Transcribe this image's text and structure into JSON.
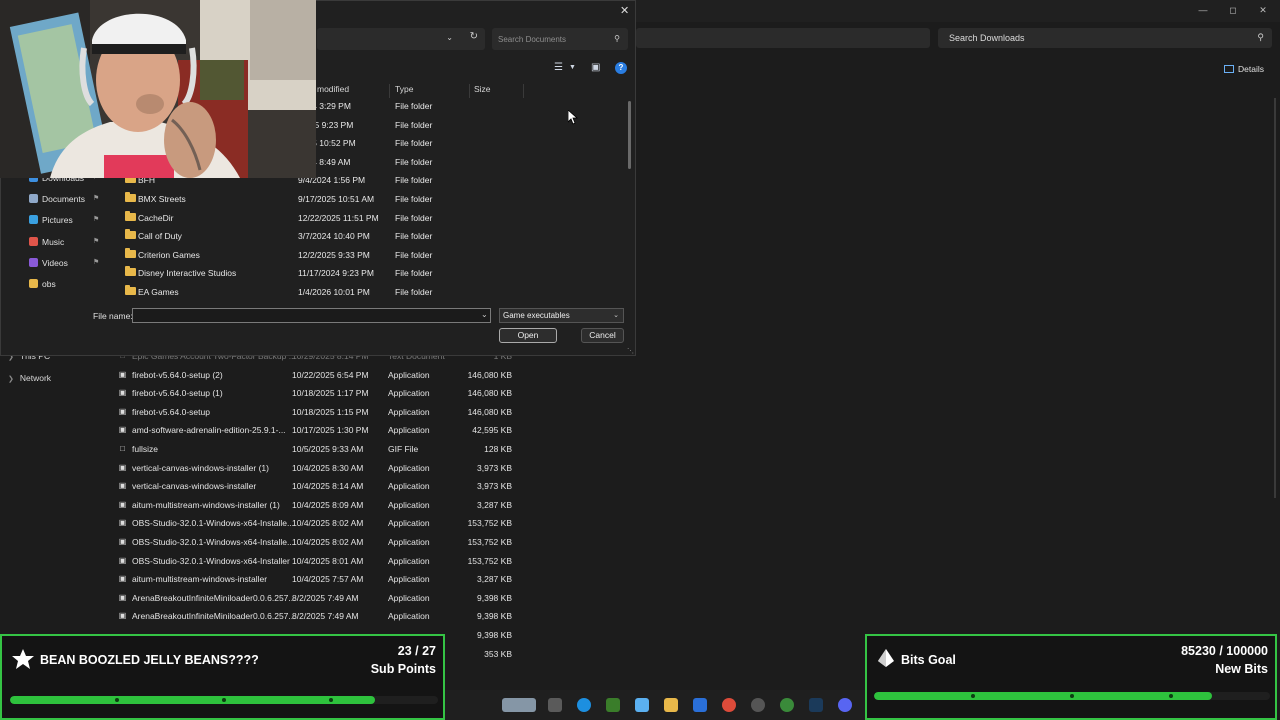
{
  "background_explorer": {
    "search_placeholder": "Search Downloads",
    "details_label": "Details",
    "nav": [
      {
        "label": "This PC"
      },
      {
        "label": "Network"
      }
    ],
    "files": [
      {
        "name": "Epic Games Account Two-Factor Backup ...",
        "date": "10/29/2025 8:14 PM",
        "type": "Text Document",
        "size": "1 KB"
      },
      {
        "name": "firebot-v5.64.0-setup (2)",
        "date": "10/22/2025 6:54 PM",
        "type": "Application",
        "size": "146,080 KB"
      },
      {
        "name": "firebot-v5.64.0-setup (1)",
        "date": "10/18/2025 1:17 PM",
        "type": "Application",
        "size": "146,080 KB"
      },
      {
        "name": "firebot-v5.64.0-setup",
        "date": "10/18/2025 1:15 PM",
        "type": "Application",
        "size": "146,080 KB"
      },
      {
        "name": "amd-software-adrenalin-edition-25.9.1-...",
        "date": "10/17/2025 1:30 PM",
        "type": "Application",
        "size": "42,595 KB"
      },
      {
        "name": "fullsize",
        "date": "10/5/2025 9:33 AM",
        "type": "GIF File",
        "size": "128 KB"
      },
      {
        "name": "vertical-canvas-windows-installer (1)",
        "date": "10/4/2025 8:30 AM",
        "type": "Application",
        "size": "3,973 KB"
      },
      {
        "name": "vertical-canvas-windows-installer",
        "date": "10/4/2025 8:14 AM",
        "type": "Application",
        "size": "3,973 KB"
      },
      {
        "name": "aitum-multistream-windows-installer (1)",
        "date": "10/4/2025 8:09 AM",
        "type": "Application",
        "size": "3,287 KB"
      },
      {
        "name": "OBS-Studio-32.0.1-Windows-x64-Installe...",
        "date": "10/4/2025 8:02 AM",
        "type": "Application",
        "size": "153,752 KB"
      },
      {
        "name": "OBS-Studio-32.0.1-Windows-x64-Installe...",
        "date": "10/4/2025 8:02 AM",
        "type": "Application",
        "size": "153,752 KB"
      },
      {
        "name": "OBS-Studio-32.0.1-Windows-x64-Installer",
        "date": "10/4/2025 8:01 AM",
        "type": "Application",
        "size": "153,752 KB"
      },
      {
        "name": "aitum-multistream-windows-installer",
        "date": "10/4/2025 7:57 AM",
        "type": "Application",
        "size": "3,287 KB"
      },
      {
        "name": "ArenaBreakoutInfiniteMiniloader0.0.6.257...",
        "date": "8/2/2025 7:49 AM",
        "type": "Application",
        "size": "9,398 KB"
      },
      {
        "name": "ArenaBreakoutInfiniteMiniloader0.0.6.257...",
        "date": "8/2/2025 7:49 AM",
        "type": "Application",
        "size": "9,398 KB"
      },
      {
        "name": "",
        "date": "",
        "type": "",
        "size": "9,398 KB"
      },
      {
        "name": "",
        "date": "",
        "type": "",
        "size": "353 KB"
      }
    ]
  },
  "dialog": {
    "search_placeholder": "Search Documents",
    "columns": {
      "modified": "modified",
      "type": "Type",
      "size": "Size"
    },
    "top_rows": [
      {
        "date": "2024 3:29 PM",
        "type": "File folder"
      },
      {
        "date": "/2025 9:23 PM",
        "type": "File folder"
      },
      {
        "date": "2025 10:52 PM",
        "type": "File folder"
      },
      {
        "date": "2024 8:49 AM",
        "type": "File folder"
      }
    ],
    "folders": [
      {
        "name": "BFH",
        "date": "9/4/2024 1:56 PM",
        "type": "File folder"
      },
      {
        "name": "BMX Streets",
        "date": "9/17/2025 10:51 AM",
        "type": "File folder"
      },
      {
        "name": "CacheDir",
        "date": "12/22/2025 11:51 PM",
        "type": "File folder"
      },
      {
        "name": "Call of Duty",
        "date": "3/7/2024 10:40 PM",
        "type": "File folder"
      },
      {
        "name": "Criterion Games",
        "date": "12/2/2025 9:33 PM",
        "type": "File folder"
      },
      {
        "name": "Disney Interactive Studios",
        "date": "11/17/2024 9:23 PM",
        "type": "File folder"
      },
      {
        "name": "EA Games",
        "date": "1/4/2026 10:01 PM",
        "type": "File folder"
      }
    ],
    "nav": [
      {
        "label": "Downloads",
        "color": "#3d8fe0"
      },
      {
        "label": "Documents",
        "color": "#8fa8c8"
      },
      {
        "label": "Pictures",
        "color": "#3aa0e0"
      },
      {
        "label": "Music",
        "color": "#e0554a"
      },
      {
        "label": "Videos",
        "color": "#8a5ad8"
      },
      {
        "label": "obs",
        "color": "#e8b84a"
      }
    ],
    "filename_label": "File name:",
    "filename_value": "",
    "filetype": "Game executables",
    "open_label": "Open",
    "cancel_label": "Cancel"
  },
  "goals": {
    "left": {
      "title": "BEAN BOOZLED JELLY BEANS????",
      "count": "23 / 27",
      "unit": "Sub Points",
      "progress": 0.852
    },
    "right": {
      "title": "Bits Goal",
      "count": "85230 / 100000",
      "unit": "New Bits",
      "progress": 0.8523
    },
    "accent": "#2ec23d"
  }
}
